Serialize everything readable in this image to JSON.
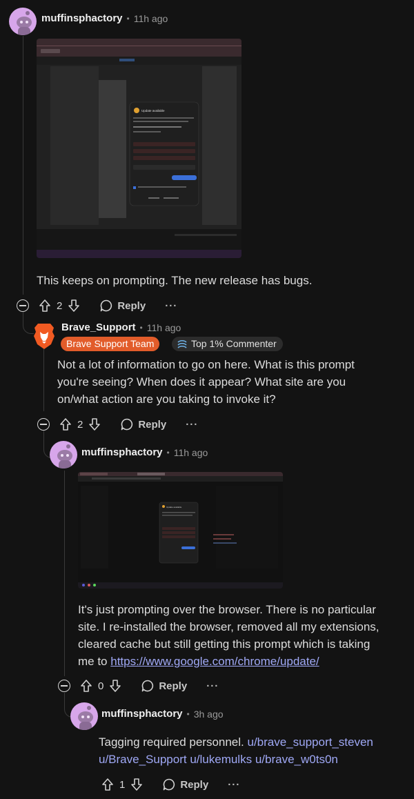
{
  "comments": [
    {
      "username": "muffinsphactory",
      "time": "11h ago",
      "text": "This keeps on prompting. The new release has bugs.",
      "votes": "2",
      "reply_label": "Reply",
      "more_label": "···"
    },
    {
      "username": "Brave_Support",
      "time": "11h ago",
      "flair": "Brave Support Team",
      "achievement": "Top 1% Commenter",
      "text_lines": [
        "Not a lot of information to go on here. What is this prompt",
        "you're seeing? When does it appear? What site are you",
        "on/what action are you taking to invoke it?"
      ],
      "votes": "2",
      "reply_label": "Reply",
      "more_label": "···"
    },
    {
      "username": "muffinsphactory",
      "time": "11h ago",
      "text_lines": [
        "It's just prompting over the browser. There is no particular",
        "site. I re-installed the browser, removed all my extensions,",
        "cleared cache but still getting this prompt which is taking"
      ],
      "text_prefix_last": "me to ",
      "link": "https://www.google.com/chrome/update/",
      "votes": "0",
      "reply_label": "Reply",
      "more_label": "···"
    },
    {
      "username": "muffinsphactory",
      "time": "3h ago",
      "text_start": "Tagging required personnel. ",
      "mentions_line1": "u/brave_support_steven",
      "mentions_line2": [
        "u/Brave_Support",
        "u/lukemulks",
        "u/brave_w0ts0n"
      ],
      "votes": "1",
      "reply_label": "Reply",
      "more_label": "···"
    }
  ],
  "screenshot1": {
    "dialog_title": "Update available",
    "button": "Update Chrome"
  },
  "screenshot2": {
    "dialog_title": "Update available"
  },
  "colors": {
    "background": "#131313",
    "link": "#9fa8f5",
    "flair_orange": "#e25c2a",
    "avatar": "#d7a6ea"
  }
}
